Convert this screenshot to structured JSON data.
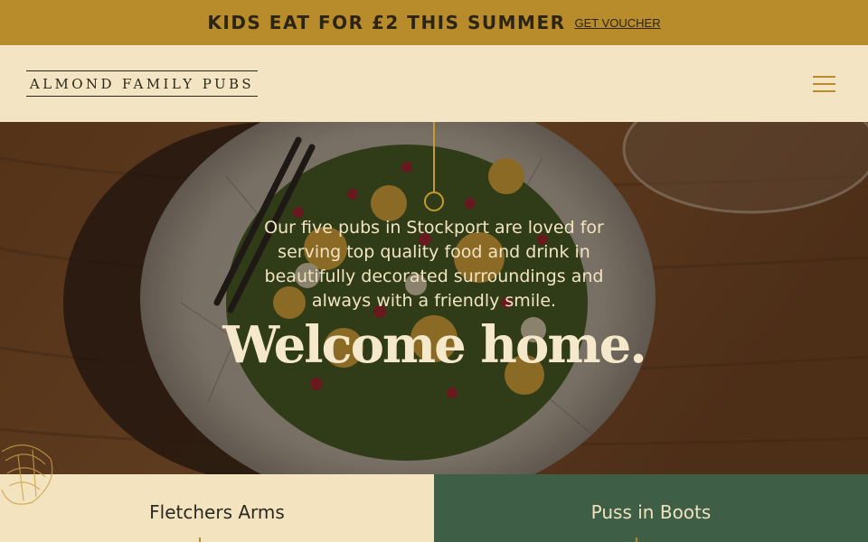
{
  "promo": {
    "text": "KIDS EAT FOR £2 THIS SUMMER",
    "link": "GET VOUCHER"
  },
  "header": {
    "logo": "ALMOND FAMILY PUBS",
    "menu_icon": "hamburger-menu-icon"
  },
  "hero": {
    "intro": "Our five pubs in Stockport are loved for serving top quality food and drink in beautifully decorated surroundings and always with a friendly smile.",
    "title": "Welcome home."
  },
  "pubs": [
    {
      "name": "Fletchers Arms"
    },
    {
      "name": "Puss in Boots"
    }
  ],
  "colors": {
    "promo_bg": "#b88c2a",
    "cream": "#f3e5c4",
    "forest_green": "#3e5e45",
    "dark_text": "#2c2818"
  }
}
